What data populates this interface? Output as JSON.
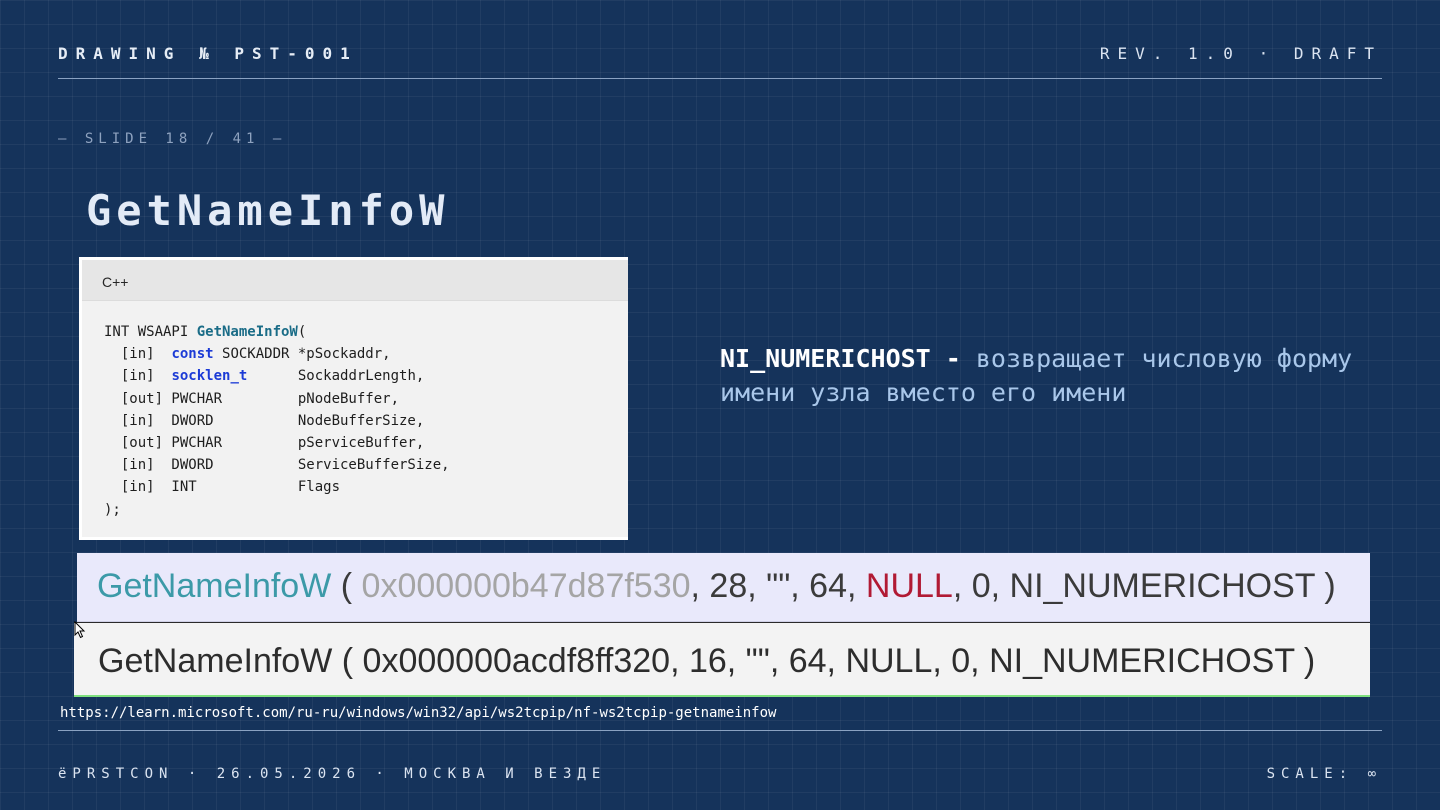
{
  "header": {
    "drawing": "DRAWING № PST-001",
    "revision": "REV. 1.0 · DRAFT"
  },
  "slide": {
    "counter": "— SLIDE 18 / 41 —",
    "title": "GetNameInfoW"
  },
  "code": {
    "language": "C++",
    "line1_prefix": "INT WSAAPI ",
    "function_name": "GetNameInfoW",
    "line1_suffix": "(",
    "line2_prefix": "  [in]  ",
    "line2_keyword": "const",
    "line2_rest": " SOCKADDR *pSockaddr,",
    "line3_prefix": "  [in]  ",
    "line3_keyword": "socklen_t",
    "line3_rest": "      SockaddrLength,",
    "line4": "  [out] PWCHAR         pNodeBuffer,",
    "line5": "  [in]  DWORD          NodeBufferSize,",
    "line6": "  [out] PWCHAR         pServiceBuffer,",
    "line7": "  [in]  DWORD          ServiceBufferSize,",
    "line8": "  [in]  INT            Flags",
    "line9": ");"
  },
  "description": {
    "flag": "NI_NUMERICHOST - ",
    "text": "возвращает числовую форму имени узла вместо его имени"
  },
  "calls": [
    {
      "fn": "GetNameInfoW",
      "open": " ( ",
      "addr": "0x000000b47d87f530",
      "mid": ", 28, \"\", 64, ",
      "null": "NULL",
      "tail": ", 0, NI_NUMERICHOST )"
    },
    {
      "fn": "GetNameInfoW",
      "open": " ( ",
      "addr": "0x000000acdf8ff320",
      "mid": ", 16, \"\", 64, ",
      "null": "NULL",
      "tail": ", 0, NI_NUMERICHOST )"
    }
  ],
  "link": "https://learn.microsoft.com/ru-ru/windows/win32/api/ws2tcpip/nf-ws2tcpip-getnameinfow",
  "footer": {
    "left": "ёPRSTCON · 26.05.2026 · МОСКВА И ВЕЗДЕ",
    "right": "SCALE: ∞"
  },
  "icons": {
    "cursor": "mouse-pointer-icon"
  }
}
